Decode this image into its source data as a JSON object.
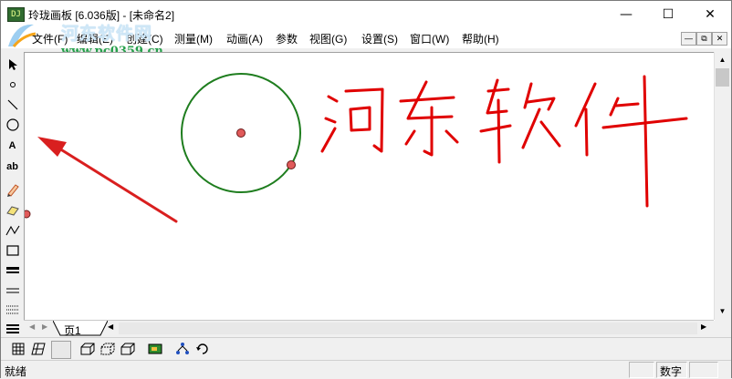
{
  "window": {
    "title": "玲珑画板 [6.036版] - [未命名2]",
    "app_icon_text": "DJ",
    "minimize_glyph": "—",
    "maximize_glyph": "☐",
    "close_glyph": "✕"
  },
  "watermark": {
    "title": "河东软件网",
    "url": "www.pc0359.cn"
  },
  "menu": [
    {
      "label": "文件(F)"
    },
    {
      "label": "编辑(E)"
    },
    {
      "label": "创建(C)"
    },
    {
      "label": "测量(M)"
    },
    {
      "label": "动画(A)"
    },
    {
      "label": "参数"
    },
    {
      "label": "视图(G)"
    },
    {
      "label": "设置(S)"
    },
    {
      "label": "窗口(W)"
    },
    {
      "label": "帮助(H)"
    }
  ],
  "mdi_controls": [
    "—",
    "⧉",
    "✕"
  ],
  "tools": [
    {
      "icon": "arrow-select-icon",
      "label": ""
    },
    {
      "icon": "point-icon",
      "label": ""
    },
    {
      "icon": "line-icon",
      "label": ""
    },
    {
      "icon": "circle-icon",
      "label": ""
    },
    {
      "icon": "text-icon",
      "label": "A"
    },
    {
      "icon": "label-icon",
      "label": "ab"
    },
    {
      "icon": "pencil-icon",
      "label": ""
    },
    {
      "icon": "eraser-icon",
      "label": ""
    },
    {
      "icon": "polyline-icon",
      "label": ""
    },
    {
      "icon": "rectangle-icon",
      "label": ""
    },
    {
      "icon": "thick-line-icon",
      "label": ""
    },
    {
      "icon": "thin-lines-icon",
      "label": ""
    },
    {
      "icon": "dotted-lines-icon",
      "label": ""
    },
    {
      "icon": "line-weight-icon",
      "label": ""
    }
  ],
  "canvas": {
    "handwriting": "河东软件",
    "circle_color": "#1e7d1e",
    "point_color": "#e05a5a",
    "ink_color": "#e00000",
    "arrow_color": "#d91f1f"
  },
  "tabs": {
    "page_tab": "页1"
  },
  "status": {
    "text": "就绪",
    "pane_numlock": "数字"
  }
}
